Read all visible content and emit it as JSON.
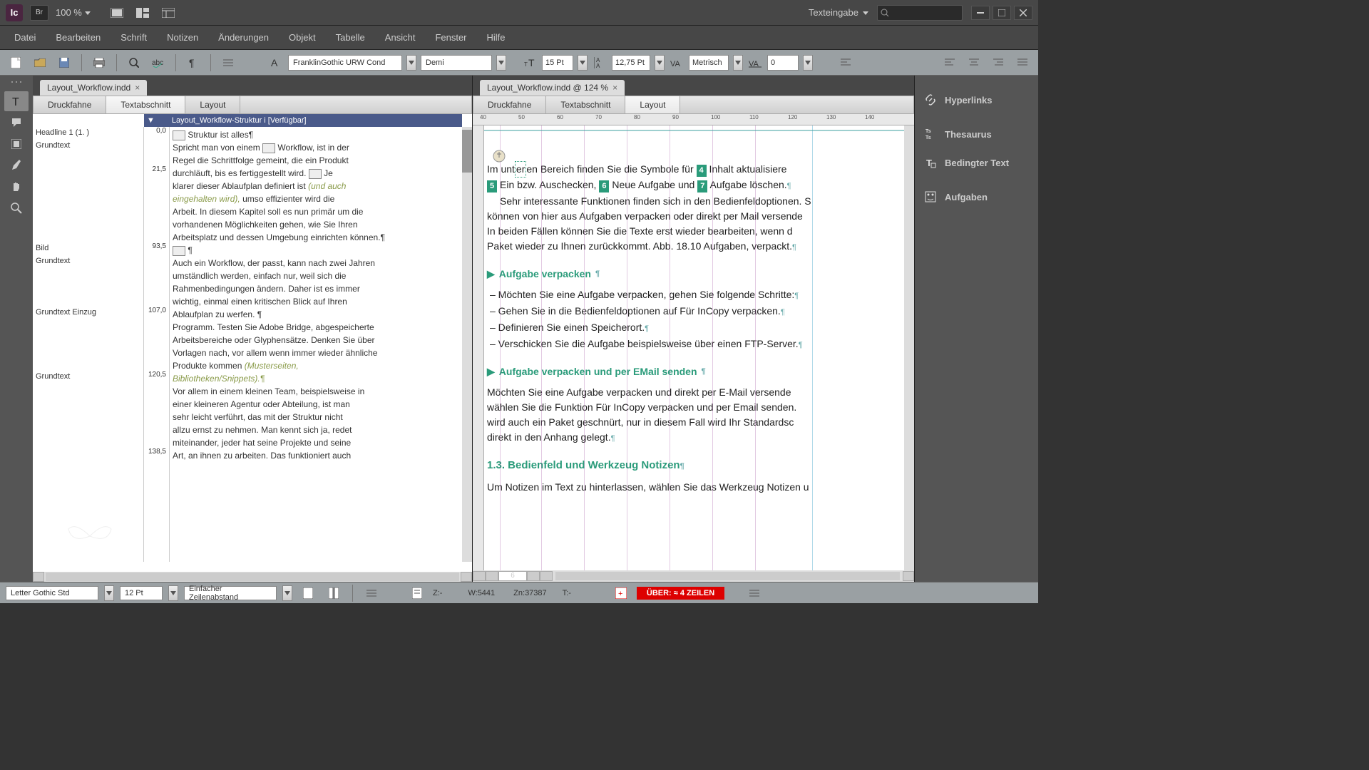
{
  "topbar": {
    "app_abbr": "Ic",
    "br_abbr": "Br",
    "zoom": "100 %",
    "workspace": "Texteingabe"
  },
  "menu": {
    "file": "Datei",
    "edit": "Bearbeiten",
    "font": "Schrift",
    "notes": "Notizen",
    "changes": "Änderungen",
    "object": "Objekt",
    "table": "Tabelle",
    "view": "Ansicht",
    "window": "Fenster",
    "help": "Hilfe"
  },
  "controlbar": {
    "font_family": "FranklinGothic URW Cond",
    "font_style": "Demi",
    "font_size": "15 Pt",
    "leading": "12,75 Pt",
    "kerning_mode": "Metrisch",
    "tracking": "0"
  },
  "left_doc": {
    "tab_title": "Layout_Workflow.indd",
    "tabs": {
      "galley": "Druckfahne",
      "story": "Textabschnitt",
      "layout": "Layout"
    },
    "story_header": "Layout_Workflow-Struktur i [Verfügbar]",
    "styles": {
      "r0": "Headline 1 (1. )",
      "r1": "Grundtext",
      "r2": "Bild",
      "r3": "Grundtext",
      "r4": "Grundtext Einzug",
      "r5": "Grundtext"
    },
    "line_nums": {
      "n0": "0,0",
      "n1": "21,5",
      "n2": "93,5",
      "n3": "107,0",
      "n4": "120,5",
      "n5": "138,5"
    },
    "content": {
      "l0": "Struktur ist alles¶",
      "l1": "Spricht man von einem ",
      "l1b": "Workflow, ist in der",
      "l2": "Regel die Schrittfolge gemeint, die ein Produkt",
      "l3": "durchläuft, bis es fertiggestellt wird. ",
      "l3b": "Je",
      "l4": "klarer dieser Ablaufplan definiert ist ",
      "l4it": "(und auch",
      "l5it": "eingehalten wird),",
      "l5": " umso effizienter wird die",
      "l6": "Arbeit. In diesem Kapitel soll es nun primär um die",
      "l7": "vorhandenen Möglichkeiten gehen, wie Sie Ihren",
      "l8": "Arbeitsplatz und dessen Umgebung einrichten können.¶",
      "l9": " ¶",
      "l10": "Auch ein Workflow, der passt, kann nach zwei Jahren",
      "l11": "umständlich werden, einfach nur, weil sich die",
      "l12": "Rahmenbedingungen ändern. Daher ist es immer",
      "l13": "wichtig, einmal einen kritischen Blick auf Ihren",
      "l14": "Ablaufplan zu werfen. ¶",
      "l15": "Programm. Testen Sie Adobe Bridge, abgespeicherte",
      "l16": "Arbeitsbereiche oder Glyphensätze. Denken Sie über",
      "l17": "Vorlagen nach, vor allem wenn immer wieder ähnliche",
      "l18": "Produkte kommen ",
      "l18it": "(Musterseiten,",
      "l19it": "Bibliotheken/Snippets).¶",
      "l20": "Vor allem in einem kleinen Team, beispielsweise in",
      "l21": "einer kleineren Agentur oder Abteilung, ist man",
      "l22": "sehr leicht verführt, das mit der Struktur nicht",
      "l23": "allzu ernst zu nehmen. Man kennt sich ja, redet",
      "l24": "miteinander, jeder hat seine Projekte und seine",
      "l25": "Art, an ihnen zu arbeiten. Das funktioniert auch"
    }
  },
  "right_doc": {
    "tab_title": "Layout_Workflow.indd @ 124 %",
    "tabs": {
      "galley": "Druckfahne",
      "story": "Textabschnitt",
      "layout": "Layout"
    },
    "ruler_ticks": {
      "t0": "40",
      "t1": "50",
      "t2": "60",
      "t3": "70",
      "t4": "80",
      "t5": "90",
      "t6": "100",
      "t7": "110",
      "t8": "120",
      "t9": "130",
      "t10": "140"
    },
    "page": {
      "p1a": "Im unt",
      "p1cursor": "er",
      "p1b": "en Bereich finden Sie die Symbole für ",
      "p1c": " Inhalt aktualisiere",
      "p2a": " Ein bzw. Auschecken, ",
      "p2b": " Neue Aufgabe und ",
      "p2c": " Aufgabe löschen.",
      "num4": "4",
      "num5": "5",
      "num6": "6",
      "num7": "7",
      "p3": "Sehr interessante Funktionen finden sich in den Bedienfeldoptionen. S",
      "p4": "können von hier aus Aufgaben verpacken oder direkt per Mail versende",
      "p5": "In beiden Fällen können Sie die Texte erst wieder bearbeiten, wenn d",
      "p6": "Paket wieder zu Ihnen zurückkommt. Abb. 18.10 Aufgaben, verpackt.",
      "h1": "Aufgabe verpacken",
      "b1": "–  Möchten Sie eine Aufgabe verpacken, gehen Sie folgende Schritte:",
      "b2": "–  Gehen Sie in die Bedienfeldoptionen auf Für InCopy verpacken.",
      "b3": "–  Definieren Sie einen Speicherort.",
      "b4": "–  Verschicken Sie die Aufgabe beispielsweise über einen FTP-Server.",
      "h2": "Aufgabe verpacken und per EMail senden",
      "p7": "Möchten Sie eine Aufgabe verpacken und direkt per E-Mail versende",
      "p8": "wählen Sie die Funktion Für InCopy verpacken und per Email senden. ",
      "p9": "wird auch ein Paket geschnürt, nur in diesem Fall wird Ihr Standardsc",
      "p10": "direkt in den Anhang gelegt.",
      "h3": "1.3.  Bedienfeld und Werkzeug Notizen",
      "p11": "Um Notizen im Text zu hinterlassen, wählen Sie das Werkzeug Notizen u"
    },
    "page_number": "6"
  },
  "panels": {
    "hyperlinks": "Hyperlinks",
    "thesaurus": "Thesaurus",
    "conditional": "Bedingter Text",
    "tasks": "Aufgaben"
  },
  "status": {
    "font": "Letter Gothic Std",
    "size": "12 Pt",
    "spacing": "Einfacher Zeilenabstand",
    "z": "Z:-",
    "w": "W:5441",
    "zn": "Zn:37387",
    "t": "T:-",
    "overset": "ÜBER:  ≈ 4 ZEILEN"
  }
}
